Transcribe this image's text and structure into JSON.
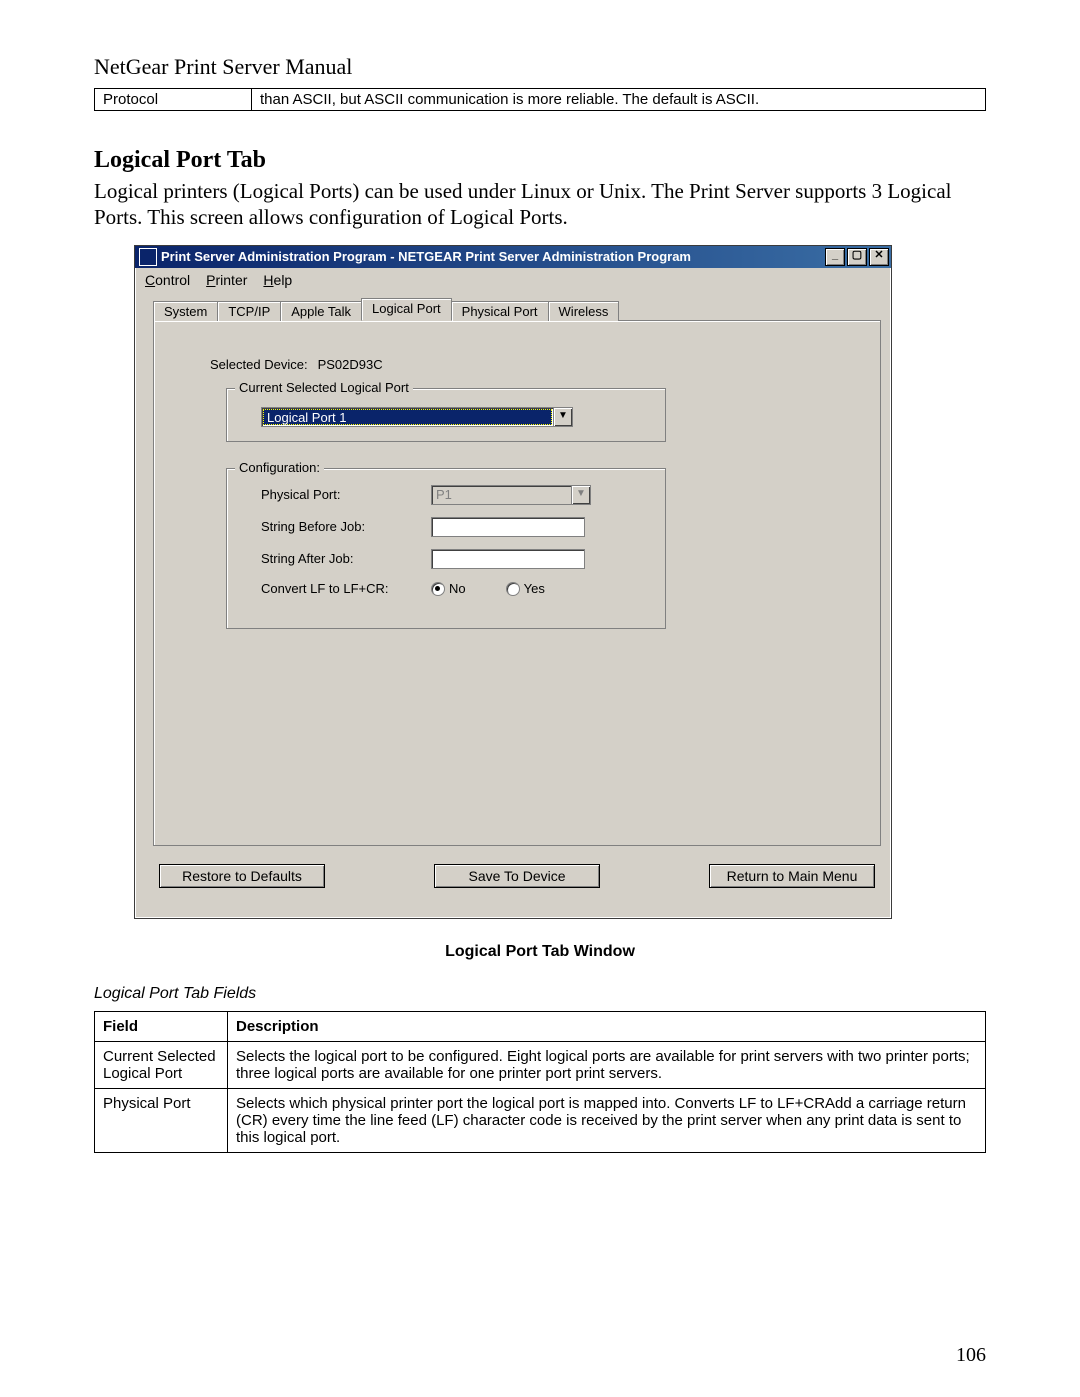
{
  "page": {
    "header": "NetGear Print Server Manual",
    "number": "106"
  },
  "top_table": {
    "c0": "Protocol",
    "c1": "than ASCII, but ASCII communication is more reliable. The default is ASCII."
  },
  "section": {
    "title": "Logical Port Tab",
    "para": "Logical printers (Logical Ports) can be used under Linux or Unix. The Print Server supports 3 Logical Ports. This screen allows configuration of Logical Ports."
  },
  "window": {
    "title": "Print Server Administration Program - NETGEAR Print Server Administration Program",
    "menus": {
      "control": "Control",
      "printer": "Printer",
      "help": "Help"
    },
    "tabs": {
      "system": "System",
      "tcpip": "TCP/IP",
      "appletalk": "Apple Talk",
      "logical": "Logical Port",
      "physical": "Physical Port",
      "wireless": "Wireless"
    },
    "selected_device_label": "Selected Device:",
    "selected_device_value": "PS02D93C",
    "group1": {
      "legend": "Current Selected Logical Port",
      "value": "Logical Port 1"
    },
    "group2": {
      "legend": "Configuration:",
      "physical_port_label": "Physical Port:",
      "physical_port_value": "P1",
      "string_before_label": "String Before Job:",
      "string_before_value": "",
      "string_after_label": "String After Job:",
      "string_after_value": "",
      "convert_label": "Convert LF to LF+CR:",
      "opt_no": "No",
      "opt_yes": "Yes"
    },
    "buttons": {
      "restore": "Restore to Defaults",
      "save": "Save To Device",
      "return": "Return to Main Menu"
    }
  },
  "caption": "Logical Port Tab Window",
  "subcaption": "Logical Port Tab Fields",
  "fields_table": {
    "h0": "Field",
    "h1": "Description",
    "rows": [
      {
        "f": "Current Selected Logical Port",
        "d": "Selects the logical port to be configured. Eight logical ports are available for print servers with two printer ports; three logical ports are available for one printer port print servers."
      },
      {
        "f": "Physical Port",
        "d": "Selects which physical printer port the logical port is mapped into. Converts LF to LF+CRAdd a carriage return (CR) every time the line feed (LF) character code is received by the print server when any print data is sent to this logical port."
      }
    ]
  }
}
